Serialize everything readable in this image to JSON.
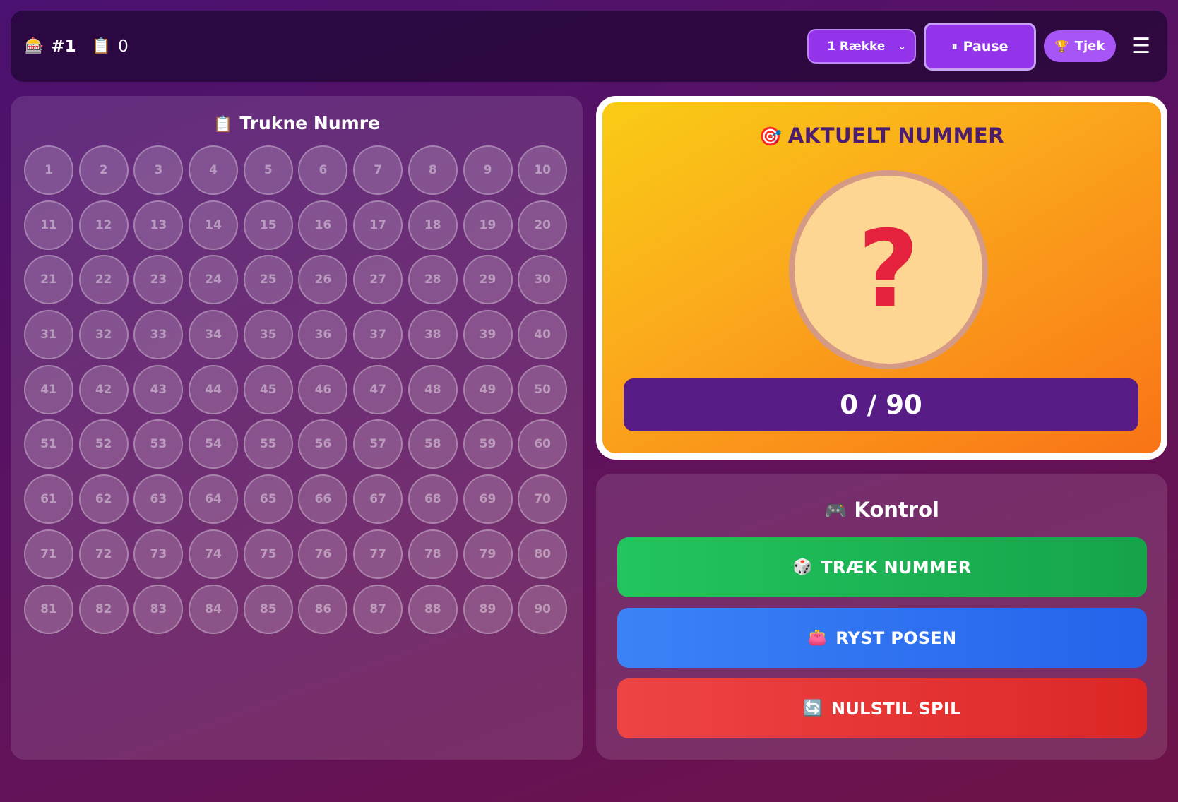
{
  "topbar": {
    "game_icon": "slot-machine-icon",
    "game_number": "#1",
    "count_icon": "clipboard-icon",
    "drawn_count": "0",
    "row_mode": "1 Række",
    "pause_label": "Pause",
    "check_label": "Tjek",
    "menu_icon": "hamburger-menu-icon"
  },
  "drawn_panel": {
    "title": "Trukne Numre",
    "title_icon": "clipboard-icon",
    "numbers": [
      "1",
      "2",
      "3",
      "4",
      "5",
      "6",
      "7",
      "8",
      "9",
      "10",
      "11",
      "12",
      "13",
      "14",
      "15",
      "16",
      "17",
      "18",
      "19",
      "20",
      "21",
      "22",
      "23",
      "24",
      "25",
      "26",
      "27",
      "28",
      "29",
      "30",
      "31",
      "32",
      "33",
      "34",
      "35",
      "36",
      "37",
      "38",
      "39",
      "40",
      "41",
      "42",
      "43",
      "44",
      "45",
      "46",
      "47",
      "48",
      "49",
      "50",
      "51",
      "52",
      "53",
      "54",
      "55",
      "56",
      "57",
      "58",
      "59",
      "60",
      "61",
      "62",
      "63",
      "64",
      "65",
      "66",
      "67",
      "68",
      "69",
      "70",
      "71",
      "72",
      "73",
      "74",
      "75",
      "76",
      "77",
      "78",
      "79",
      "80",
      "81",
      "82",
      "83",
      "84",
      "85",
      "86",
      "87",
      "88",
      "89",
      "90"
    ]
  },
  "current": {
    "title": "AKTUELT NUMMER",
    "title_icon": "target-icon",
    "value": "?",
    "progress": "0 / 90"
  },
  "control": {
    "title": "Kontrol",
    "title_icon": "gamepad-icon",
    "draw_label": "TRÆK NUMMER",
    "draw_icon": "dice-icon",
    "shake_label": "RYST POSEN",
    "shake_icon": "pouch-icon",
    "reset_label": "NULSTIL SPIL",
    "reset_icon": "refresh-icon"
  },
  "colors": {
    "accent_purple": "#9333ea",
    "current_card_gradient": [
      "#facc15",
      "#f97316"
    ],
    "draw_button": "#22c55e",
    "shake_button": "#3b82f6",
    "reset_button": "#ef4444"
  }
}
